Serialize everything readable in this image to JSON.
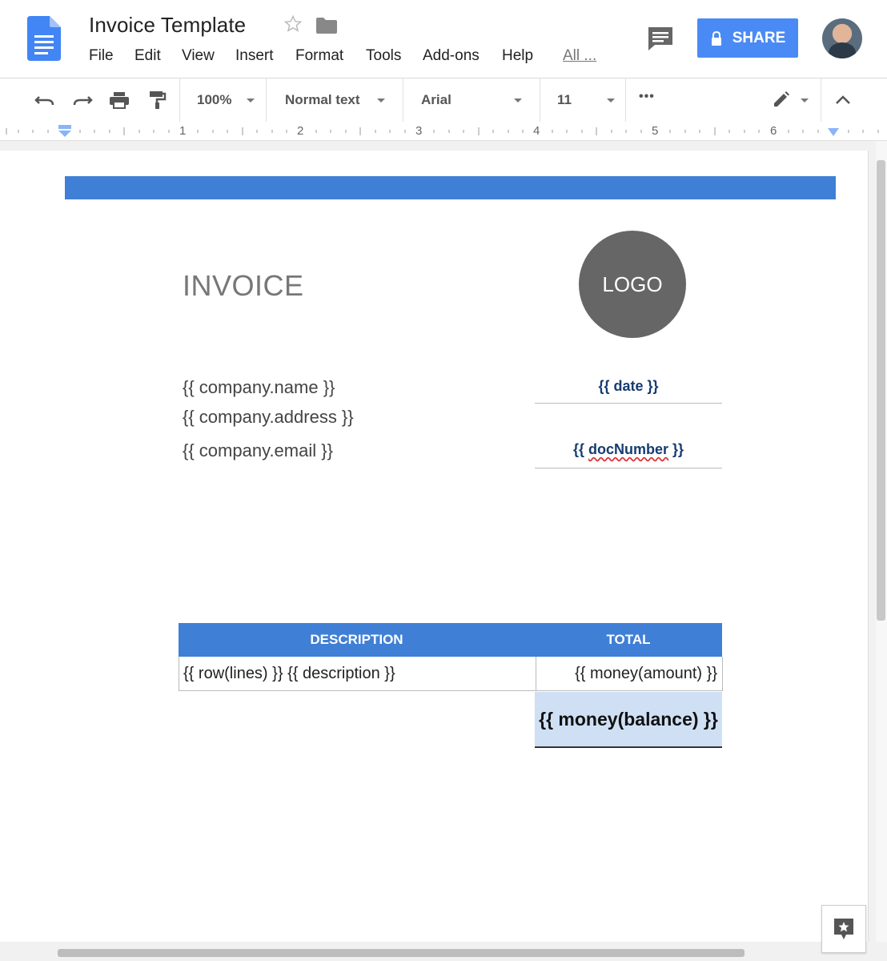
{
  "app": {
    "title": "Invoice Template",
    "menus": [
      "File",
      "Edit",
      "View",
      "Insert",
      "Format",
      "Tools",
      "Add-ons",
      "Help",
      "All ..."
    ],
    "share_label": "SHARE",
    "colors": {
      "share_blue": "#4a8af4",
      "header_bar_blue": "#3f7fd6",
      "balance_fill": "#cfe0f5"
    }
  },
  "toolbar": {
    "zoom": "100%",
    "style": "Normal text",
    "font": "Arial",
    "size": "11",
    "more": "•••"
  },
  "ruler": {
    "numbers": [
      "1",
      "2",
      "3",
      "4",
      "5",
      "6"
    ]
  },
  "document": {
    "invoice_title": "INVOICE",
    "logo_label": "LOGO",
    "company_name": "{{ company.name }}",
    "company_address": "{{ company.address }}",
    "company_email": "{{ company.email }}",
    "date_field": "{{ date }}",
    "doc_prefix": "{{ ",
    "doc_word": "docNumber",
    "doc_suffix": " }}",
    "table": {
      "headers": [
        "DESCRIPTION",
        "TOTAL"
      ],
      "row_description": "{{ row(lines) }} {{ description }}",
      "row_amount": "{{ money(amount) }}",
      "balance": "{{ money(balance) }}"
    }
  }
}
